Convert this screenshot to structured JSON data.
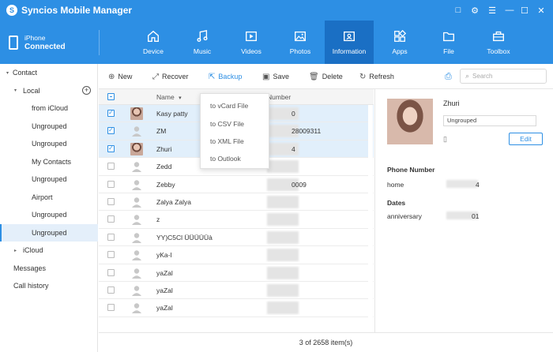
{
  "app": {
    "title": "Syncios Mobile Manager",
    "logo_letter": "S"
  },
  "window_controls": [
    "□",
    "⚙",
    "☰",
    "—",
    "☐",
    "✕"
  ],
  "device": {
    "name": "iPhone",
    "status": "Connected"
  },
  "nav": {
    "tabs": [
      {
        "label": "Device",
        "icon": "home-icon"
      },
      {
        "label": "Music",
        "icon": "music-icon"
      },
      {
        "label": "Videos",
        "icon": "video-icon"
      },
      {
        "label": "Photos",
        "icon": "photo-icon"
      },
      {
        "label": "Information",
        "icon": "contact-card-icon",
        "active": true
      },
      {
        "label": "Apps",
        "icon": "apps-icon"
      },
      {
        "label": "File",
        "icon": "folder-icon"
      },
      {
        "label": "Toolbox",
        "icon": "toolbox-icon"
      }
    ]
  },
  "sidebar": {
    "items": [
      {
        "label": "Contact",
        "level": 0,
        "caret": "▾"
      },
      {
        "label": "Local",
        "level": 1,
        "caret": "▾"
      },
      {
        "label": "from iCloud",
        "level": 2
      },
      {
        "label": "Ungrouped",
        "level": 2
      },
      {
        "label": "Ungrouped",
        "level": 2
      },
      {
        "label": "My Contacts",
        "level": 2
      },
      {
        "label": "Ungrouped",
        "level": 2
      },
      {
        "label": "Airport",
        "level": 2
      },
      {
        "label": "Ungrouped",
        "level": 2
      },
      {
        "label": "Ungrouped",
        "level": 2,
        "selected": true
      },
      {
        "label": "iCloud",
        "level": 1,
        "caret": "▸"
      },
      {
        "label": "Messages",
        "level": 0
      },
      {
        "label": "Call history",
        "level": 0
      }
    ],
    "add_symbol": "+"
  },
  "toolbar": {
    "new": "New",
    "recover": "Recover",
    "backup": "Backup",
    "save": "Save",
    "delete": "Delete",
    "refresh": "Refresh",
    "search_placeholder": "Search"
  },
  "table": {
    "columns": {
      "name": "Name",
      "name_sort": "▾",
      "number": "Number"
    },
    "rows": [
      {
        "name": "Kasy patty",
        "number": "0",
        "checked": true,
        "photo": true
      },
      {
        "name": "ZM",
        "number": "28009311",
        "checked": true,
        "photo": false
      },
      {
        "name": "Zhuri",
        "number": "4",
        "checked": true,
        "photo": true
      },
      {
        "name": "Zedd",
        "number": "",
        "checked": false,
        "photo": false
      },
      {
        "name": "Zebby",
        "number": "0009",
        "checked": false,
        "photo": false
      },
      {
        "name": "Zalya Zalya",
        "number": "",
        "checked": false,
        "photo": false
      },
      {
        "name": "z",
        "number": "",
        "checked": false,
        "photo": false
      },
      {
        "name": "YY)C5Cl ÜÜÜÜÜà",
        "number": "",
        "checked": false,
        "photo": false
      },
      {
        "name": "yKa-l",
        "number": "",
        "checked": false,
        "photo": false
      },
      {
        "name": "yaZal",
        "number": "",
        "checked": false,
        "photo": false
      },
      {
        "name": "yaZal",
        "number": "",
        "checked": false,
        "photo": false
      },
      {
        "name": "yaZal",
        "number": "",
        "checked": false,
        "photo": false
      }
    ]
  },
  "backup_menu": [
    "to vCard File",
    "to CSV File",
    "to XML File",
    "to Outlook"
  ],
  "footer": {
    "status": "3 of 2658 item(s)"
  },
  "detail": {
    "name": "Zhuri",
    "group": "Ungrouped",
    "edit": "Edit",
    "phone_section": "Phone Number",
    "phone_key": "home",
    "phone_value": "4",
    "dates_section": "Dates",
    "date_key": "anniversary",
    "date_value": "01"
  },
  "colors": {
    "accent": "#2d8fe4",
    "accent_dark": "#1a6fc4",
    "selected_row": "#e1effb"
  }
}
